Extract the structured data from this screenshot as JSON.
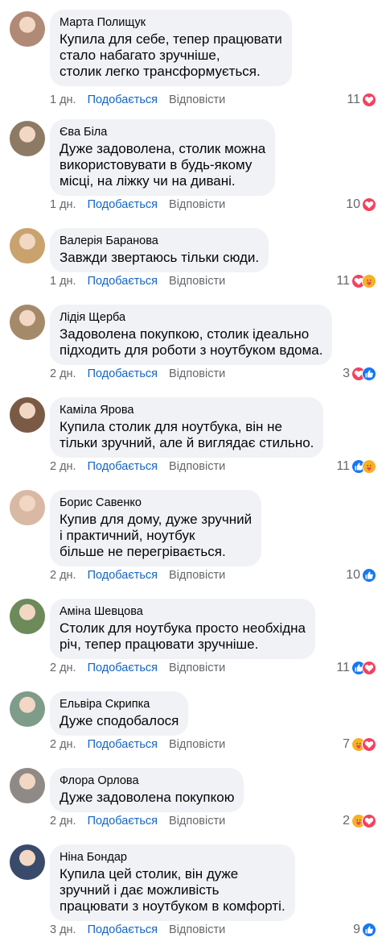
{
  "comments": [
    {
      "name": "Марта Полищук",
      "text": "Купила для себе, тепер працювати\nстало набагато зручніше,\nстолик легко трансформується.",
      "time": "1 дн.",
      "like": "Подобається",
      "reply": "Відповісти",
      "count": "11",
      "reactions": [
        "love"
      ],
      "avatar_color": "#b08a76"
    },
    {
      "name": "Єва Біла",
      "text": "Дуже задоволена, столик можна\nвикористовувати в будь-якому\nмісці, на ліжку чи на дивані.",
      "time": "1 дн.",
      "like": "Подобається",
      "reply": "Відповісти",
      "count": "10",
      "reactions": [
        "love"
      ],
      "avatar_color": "#8d7a64"
    },
    {
      "name": "Валерія Баранова",
      "text": "Завжди звертаюсь тільки сюди.",
      "time": "1 дн.",
      "like": "Подобається",
      "reply": "Відповісти",
      "count": "11",
      "reactions": [
        "love",
        "care"
      ],
      "avatar_color": "#c9a26e"
    },
    {
      "name": "Лідія Щерба",
      "text": "Задоволена покупкою, столик ідеально\nпідходить для роботи з ноутбуком вдома.",
      "time": "2 дн.",
      "like": "Подобається",
      "reply": "Відповісти",
      "count": "3",
      "reactions": [
        "love",
        "like"
      ],
      "avatar_color": "#a58a6a"
    },
    {
      "name": "Каміла Ярова",
      "text": "Купила столик для ноутбука, він не\nтільки зручний, але й виглядає стильно.",
      "time": "2 дн.",
      "like": "Подобається",
      "reply": "Відповісти",
      "count": "11",
      "reactions": [
        "like",
        "care"
      ],
      "avatar_color": "#7b5a45"
    },
    {
      "name": "Борис Савенко",
      "text": "Купив для дому, дуже зручний\nі практичний, ноутбук\nбільше не перегрівається.",
      "time": "2 дн.",
      "like": "Подобається",
      "reply": "Відповісти",
      "count": "10",
      "reactions": [
        "like"
      ],
      "avatar_color": "#d9b9a3"
    },
    {
      "name": "Аміна Шевцова",
      "text": "Столик для ноутбука просто необхідна\nріч, тепер працювати зручніше.",
      "time": "2 дн.",
      "like": "Подобається",
      "reply": "Відповісти",
      "count": "11",
      "reactions": [
        "like",
        "love"
      ],
      "avatar_color": "#6d8a5a"
    },
    {
      "name": "Ельвіра Скрипка",
      "text": "Дуже сподобалося",
      "time": "2 дн.",
      "like": "Подобається",
      "reply": "Відповісти",
      "count": "7",
      "reactions": [
        "care",
        "love"
      ],
      "avatar_color": "#7f9c8a"
    },
    {
      "name": "Флора Орлова",
      "text": "Дуже задоволена покупкою",
      "time": "2 дн.",
      "like": "Подобається",
      "reply": "Відповісти",
      "count": "2",
      "reactions": [
        "care",
        "love"
      ],
      "avatar_color": "#8f8a86"
    },
    {
      "name": "Ніна Бондар",
      "text": "Купила цей столик, він дуже\nзручний і дає можливість\nпрацювати з ноутбуком в комфорті.",
      "time": "3 дн.",
      "like": "Подобається",
      "reply": "Відповісти",
      "count": "9",
      "reactions": [
        "like"
      ],
      "avatar_color": "#3a4a6a"
    }
  ]
}
